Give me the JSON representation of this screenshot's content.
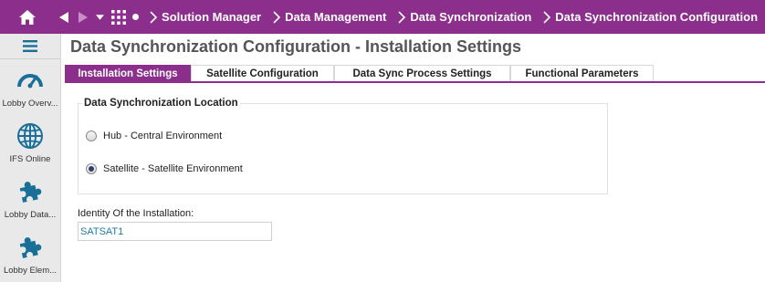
{
  "topbar": {
    "breadcrumbs": [
      {
        "label": "Solution Manager"
      },
      {
        "label": "Data Management"
      },
      {
        "label": "Data Synchronization"
      },
      {
        "label": "Data Synchronization Configuration"
      }
    ],
    "icons": [
      "home-icon",
      "back-arrow-icon",
      "forward-arrow-icon",
      "dropdown-icon",
      "apps-grid-icon",
      "dot-icon"
    ]
  },
  "sidebar": {
    "items": [
      {
        "label": "Lobby Overv...",
        "icon": "gauge-icon"
      },
      {
        "label": "IFS Online",
        "icon": "globe-icon"
      },
      {
        "label": "Lobby Data...",
        "icon": "puzzle-icon"
      },
      {
        "label": "Lobby Elem...",
        "icon": "puzzle-icon"
      }
    ]
  },
  "page": {
    "title": "Data Synchronization Configuration - Installation Settings"
  },
  "tabs": [
    {
      "label": "Installation Settings",
      "active": true
    },
    {
      "label": "Satellite Configuration",
      "active": false
    },
    {
      "label": "Data Sync Process Settings",
      "active": false
    },
    {
      "label": "Functional Parameters",
      "active": false
    }
  ],
  "location_group": {
    "title": "Data Synchronization Location",
    "options": [
      {
        "label": "Hub - Central Environment",
        "checked": false
      },
      {
        "label": "Satellite - Satellite Environment",
        "checked": true
      }
    ]
  },
  "identity_field": {
    "label": "Identity Of the Installation:",
    "value": "SATSAT1"
  },
  "colors": {
    "accent": "#8c2f8c",
    "link_icon": "#1a6f99"
  }
}
